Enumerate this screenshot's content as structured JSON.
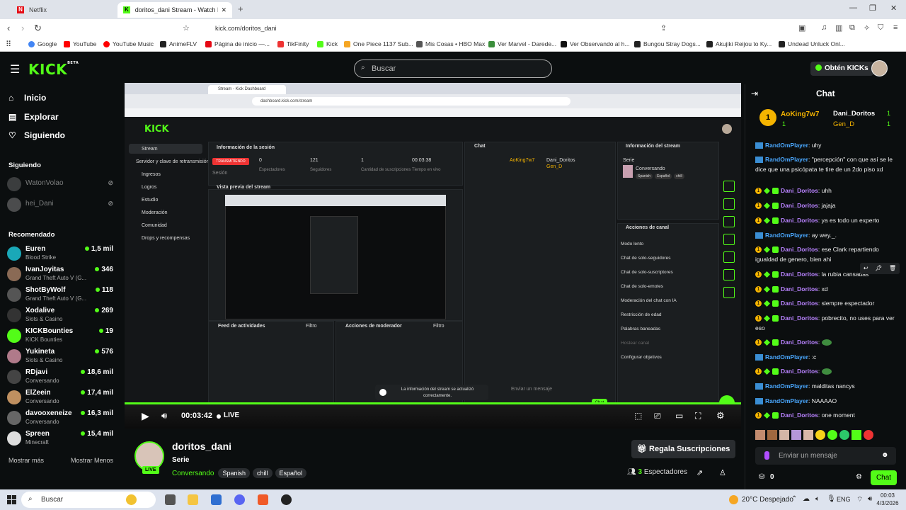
{
  "browser": {
    "tabs": [
      {
        "title": "Netflix"
      },
      {
        "title": "doritos_dani Stream - Watch Live"
      }
    ],
    "new_tab": "+",
    "url": "kick.com/doritos_dani",
    "bookmarks": [
      "Google",
      "YouTube",
      "YouTube Music",
      "AnimeFLV",
      "Página de inicio —...",
      "TikFinity",
      "Kick",
      "One Piece 1137 Sub...",
      "Mis Cosas • HBO Max",
      "Ver Marvel - Darede...",
      "Ver Observando al h...",
      "Bungou Stray Dogs...",
      "Akujiki Reijou to Ky...",
      "Undead Unluck Onl..."
    ]
  },
  "kick": {
    "logo": "KICK",
    "logo_badge": "BETA",
    "search_placeholder": "Buscar",
    "kicks_button": "Obtén KICKs",
    "nav": [
      {
        "label": "Inicio"
      },
      {
        "label": "Explorar"
      },
      {
        "label": "Siguiendo"
      }
    ],
    "following_title": "Siguiendo",
    "following": [
      {
        "name": "WatonVolao"
      },
      {
        "name": "hei_Dani"
      }
    ],
    "recommended_title": "Recomendado",
    "recommended": [
      {
        "name": "Euren",
        "category": "Blood Strike",
        "viewers": "1,5 mil",
        "color": "#1aa8b8"
      },
      {
        "name": "IvanJoyitas",
        "category": "Grand Theft Auto V (G...",
        "viewers": "346",
        "color": "#8a6a55"
      },
      {
        "name": "ShotByWolf",
        "category": "Grand Theft Auto V (G...",
        "viewers": "118",
        "color": "#555"
      },
      {
        "name": "Xodalive",
        "category": "Slots & Casino",
        "viewers": "269",
        "color": "#333"
      },
      {
        "name": "KICKBounties",
        "category": "KICK Bounties",
        "viewers": "19",
        "color": "#53fc18"
      },
      {
        "name": "Yukineta",
        "category": "Slots & Casino",
        "viewers": "576",
        "color": "#b07a8a"
      },
      {
        "name": "RDjavi",
        "category": "Conversando",
        "viewers": "18,6 mil",
        "color": "#444"
      },
      {
        "name": "ElZeein",
        "category": "Conversando",
        "viewers": "17,4 mil",
        "color": "#c09060"
      },
      {
        "name": "davooxeneize",
        "category": "Conversando",
        "viewers": "16,3 mil",
        "color": "#666"
      },
      {
        "name": "Spreen",
        "category": "Minecraft",
        "viewers": "15,4 mil",
        "color": "#ddd"
      }
    ],
    "show_more": "Mostrar más",
    "show_less": "Mostrar Menos"
  },
  "player": {
    "time": "00:03:42",
    "live": "LIVE",
    "inner": {
      "tab": "Stream - Kick Dashboard",
      "url": "dashboard.kick.com/stream",
      "menu": [
        "Stream",
        "Servidor y clave de retransmisión",
        "Ingresos",
        "Logros",
        "Estudio",
        "Moderación",
        "Comunidad",
        "Drops y recompensas"
      ],
      "session_title": "Información de la sesión",
      "status": "TRANSMITIENDO",
      "stats": [
        {
          "v": "0",
          "l": "Espectadores"
        },
        {
          "v": "121",
          "l": "Seguidores"
        },
        {
          "v": "1",
          "l": "Cantidad de suscripciones"
        },
        {
          "v": "00:03:38",
          "l": "Tiempo en vivo"
        }
      ],
      "session_label": "Sesión",
      "preview_title": "Vista previa del stream",
      "chat_title": "Chat",
      "stream_info_title": "Información del stream",
      "serie": "Serie",
      "conversando": "Conversando",
      "tags": [
        "Spanish",
        "Español",
        "chill"
      ],
      "channel_actions": "Acciones de canal",
      "actions": [
        "Modo lento",
        "Chat de solo-seguidores",
        "Chat de solo-suscriptores",
        "Chat de solo-emotes",
        "Moderación del chat con IA",
        "Restricción de edad",
        "Palabras baneadas",
        "Hostear canal",
        "Configurar objetivos"
      ],
      "feed_title": "Feed de actividades",
      "mod_title": "Acciones de moderador",
      "filter": "Filtro",
      "toast": "La información del stream se actualizó correctamente.",
      "send_placeholder": "Enviar un mensaje",
      "chat_users": [
        "AoKing7w7",
        "Dani_Doritos",
        "Gen_D"
      ],
      "chat_btn": "Chat"
    }
  },
  "stream": {
    "channel": "doritos_dani",
    "live_badge": "LIVE",
    "title": "Serie",
    "category": "Conversando",
    "tags": [
      "Spanish",
      "chill",
      "Español"
    ],
    "sub_button": "Regala Suscripciones",
    "viewers_count": "3",
    "viewers_label": "Espectadores"
  },
  "chat": {
    "title": "Chat",
    "top": [
      {
        "name": "AoKing7w7",
        "count": "1"
      },
      {
        "name": "Dani_Doritos",
        "count": "1"
      },
      {
        "name": "Gen_D",
        "count": "1"
      }
    ],
    "messages": [
      {
        "user": "RandOmPlayer",
        "text": "uhy",
        "type": "r"
      },
      {
        "user": "RandOmPlayer",
        "text": "\"percepción\" con que así se le dice que una psicópata te tire de un 2do piso xd",
        "type": "r"
      },
      {
        "user": "Dani_Doritos",
        "text": "uhh",
        "type": "d"
      },
      {
        "user": "Dani_Doritos",
        "text": "jajaja",
        "type": "d"
      },
      {
        "user": "Dani_Doritos",
        "text": "ya es todo un experto",
        "type": "d"
      },
      {
        "user": "RandOmPlayer",
        "text": "ay wey._.",
        "type": "r"
      },
      {
        "user": "Dani_Doritos",
        "text": "ese Clark repartiendo igualdad de genero, bien ahi",
        "type": "d"
      },
      {
        "user": "Dani_Doritos",
        "text": "la rubia cansadas",
        "type": "d"
      },
      {
        "user": "Dani_Doritos",
        "text": "xd",
        "type": "d"
      },
      {
        "user": "Dani_Doritos",
        "text": "siempre espectador",
        "type": "d"
      },
      {
        "user": "Dani_Doritos",
        "text": "pobrecito, no uses para ver eso",
        "type": "d"
      },
      {
        "user": "Dani_Doritos",
        "text": "",
        "type": "d"
      },
      {
        "user": "RandOmPlayer",
        "text": ":c",
        "type": "r"
      },
      {
        "user": "Dani_Doritos",
        "text": "",
        "type": "d"
      },
      {
        "user": "RandOmPlayer",
        "text": "malditas nancys",
        "type": "r"
      },
      {
        "user": "RandOmPlayer",
        "text": "NAAAAO",
        "type": "r"
      },
      {
        "user": "Dani_Doritos",
        "text": "one moment",
        "type": "d"
      }
    ],
    "input_placeholder": "Enviar un mensaje",
    "points": "0",
    "send": "Chat"
  },
  "taskbar": {
    "search": "Buscar",
    "weather": "20°C  Despejado",
    "lang": "ENG",
    "time": "00:03",
    "date": "4/3/2026"
  }
}
